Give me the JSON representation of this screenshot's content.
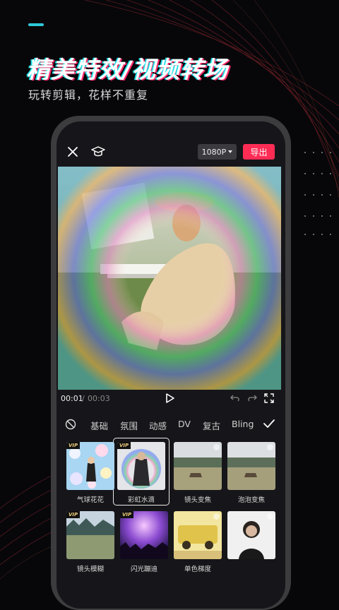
{
  "headline": "精美特效/视频转场",
  "subheadline": "玩转剪辑，花样不重复",
  "editor": {
    "resolution": "1080P",
    "export_label": "导出",
    "time_current": "00:01",
    "time_separator": "/",
    "time_total": "00:03"
  },
  "categories": [
    "基础",
    "氛围",
    "动感",
    "DV",
    "复古",
    "Bling"
  ],
  "effects": [
    {
      "label": "气球花花",
      "vip": true,
      "selected": false
    },
    {
      "label": "彩虹水滴",
      "vip": true,
      "selected": true
    },
    {
      "label": "镜头变焦",
      "vip": false,
      "selected": false
    },
    {
      "label": "泡泡变焦",
      "vip": false,
      "selected": false
    },
    {
      "label": "镜头模糊",
      "vip": true,
      "selected": false
    },
    {
      "label": "闪光蹦迪",
      "vip": true,
      "selected": false
    },
    {
      "label": "单色梯度",
      "vip": false,
      "selected": false
    },
    {
      "label": "",
      "vip": false,
      "selected": false
    }
  ],
  "vip_badge": "VIP",
  "colors": {
    "accent": "#fe2c55",
    "background": "#07070a",
    "glitch_cyan": "#1ee0e8"
  }
}
